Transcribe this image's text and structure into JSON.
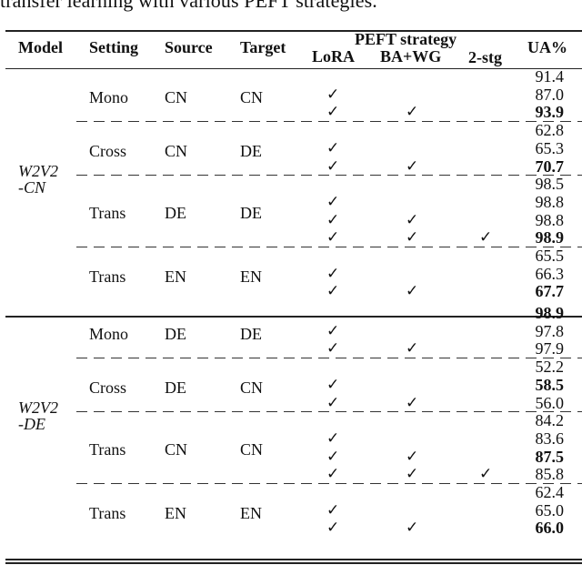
{
  "caption": "transfer learning with various PEFT strategies.",
  "header": {
    "model": "Model",
    "setting": "Setting",
    "source": "Source",
    "target": "Target",
    "peft_group": "PEFT strategy",
    "lora": "LoRA",
    "bawg": "BA+WG",
    "twostg": "2-stg",
    "ua": "UA%"
  },
  "check_glyph": "✓",
  "models": [
    {
      "line1": "W2V2",
      "line2": "-CN"
    },
    {
      "line1": "W2V2",
      "line2": "-DE"
    }
  ],
  "groups": [
    {
      "model": 0,
      "setting": "Mono",
      "source": "CN",
      "target": "CN",
      "rows": [
        {
          "lora": false,
          "bawg": false,
          "twostg": false,
          "ua": "91.4",
          "bold": false
        },
        {
          "lora": true,
          "bawg": false,
          "twostg": false,
          "ua": "87.0",
          "bold": false
        },
        {
          "lora": true,
          "bawg": true,
          "twostg": false,
          "ua": "93.9",
          "bold": true
        }
      ]
    },
    {
      "model": 0,
      "setting": "Cross",
      "source": "CN",
      "target": "DE",
      "rows": [
        {
          "lora": false,
          "bawg": false,
          "twostg": false,
          "ua": "62.8",
          "bold": false
        },
        {
          "lora": true,
          "bawg": false,
          "twostg": false,
          "ua": "65.3",
          "bold": false
        },
        {
          "lora": true,
          "bawg": true,
          "twostg": false,
          "ua": "70.7",
          "bold": true
        }
      ]
    },
    {
      "model": 0,
      "setting": "Trans",
      "source": "DE",
      "target": "DE",
      "rows": [
        {
          "lora": false,
          "bawg": false,
          "twostg": false,
          "ua": "98.5",
          "bold": false
        },
        {
          "lora": true,
          "bawg": false,
          "twostg": false,
          "ua": "98.8",
          "bold": false
        },
        {
          "lora": true,
          "bawg": true,
          "twostg": false,
          "ua": "98.8",
          "bold": false
        },
        {
          "lora": true,
          "bawg": true,
          "twostg": true,
          "ua": "98.9",
          "bold": true
        }
      ]
    },
    {
      "model": 0,
      "setting": "Trans",
      "source": "EN",
      "target": "EN",
      "rows": [
        {
          "lora": false,
          "bawg": false,
          "twostg": false,
          "ua": "65.5",
          "bold": false
        },
        {
          "lora": true,
          "bawg": false,
          "twostg": false,
          "ua": "66.3",
          "bold": false
        },
        {
          "lora": true,
          "bawg": true,
          "twostg": false,
          "ua": "67.7",
          "bold": true
        }
      ]
    },
    {
      "model": 1,
      "setting": "Mono",
      "source": "DE",
      "target": "DE",
      "rows": [
        {
          "lora": false,
          "bawg": false,
          "twostg": false,
          "ua": "98.9",
          "bold": true
        },
        {
          "lora": true,
          "bawg": false,
          "twostg": false,
          "ua": "97.8",
          "bold": false
        },
        {
          "lora": true,
          "bawg": true,
          "twostg": false,
          "ua": "97.9",
          "bold": false
        }
      ]
    },
    {
      "model": 1,
      "setting": "Cross",
      "source": "DE",
      "target": "CN",
      "rows": [
        {
          "lora": false,
          "bawg": false,
          "twostg": false,
          "ua": "52.2",
          "bold": false
        },
        {
          "lora": true,
          "bawg": false,
          "twostg": false,
          "ua": "58.5",
          "bold": true
        },
        {
          "lora": true,
          "bawg": true,
          "twostg": false,
          "ua": "56.0",
          "bold": false
        }
      ]
    },
    {
      "model": 1,
      "setting": "Trans",
      "source": "CN",
      "target": "CN",
      "rows": [
        {
          "lora": false,
          "bawg": false,
          "twostg": false,
          "ua": "84.2",
          "bold": false
        },
        {
          "lora": true,
          "bawg": false,
          "twostg": false,
          "ua": "83.6",
          "bold": false
        },
        {
          "lora": true,
          "bawg": true,
          "twostg": false,
          "ua": "87.5",
          "bold": true
        },
        {
          "lora": true,
          "bawg": true,
          "twostg": true,
          "ua": "85.8",
          "bold": false
        }
      ]
    },
    {
      "model": 1,
      "setting": "Trans",
      "source": "EN",
      "target": "EN",
      "rows": [
        {
          "lora": false,
          "bawg": false,
          "twostg": false,
          "ua": "62.4",
          "bold": false
        },
        {
          "lora": true,
          "bawg": false,
          "twostg": false,
          "ua": "65.0",
          "bold": false
        },
        {
          "lora": true,
          "bawg": true,
          "twostg": false,
          "ua": "66.0",
          "bold": true
        }
      ]
    }
  ]
}
